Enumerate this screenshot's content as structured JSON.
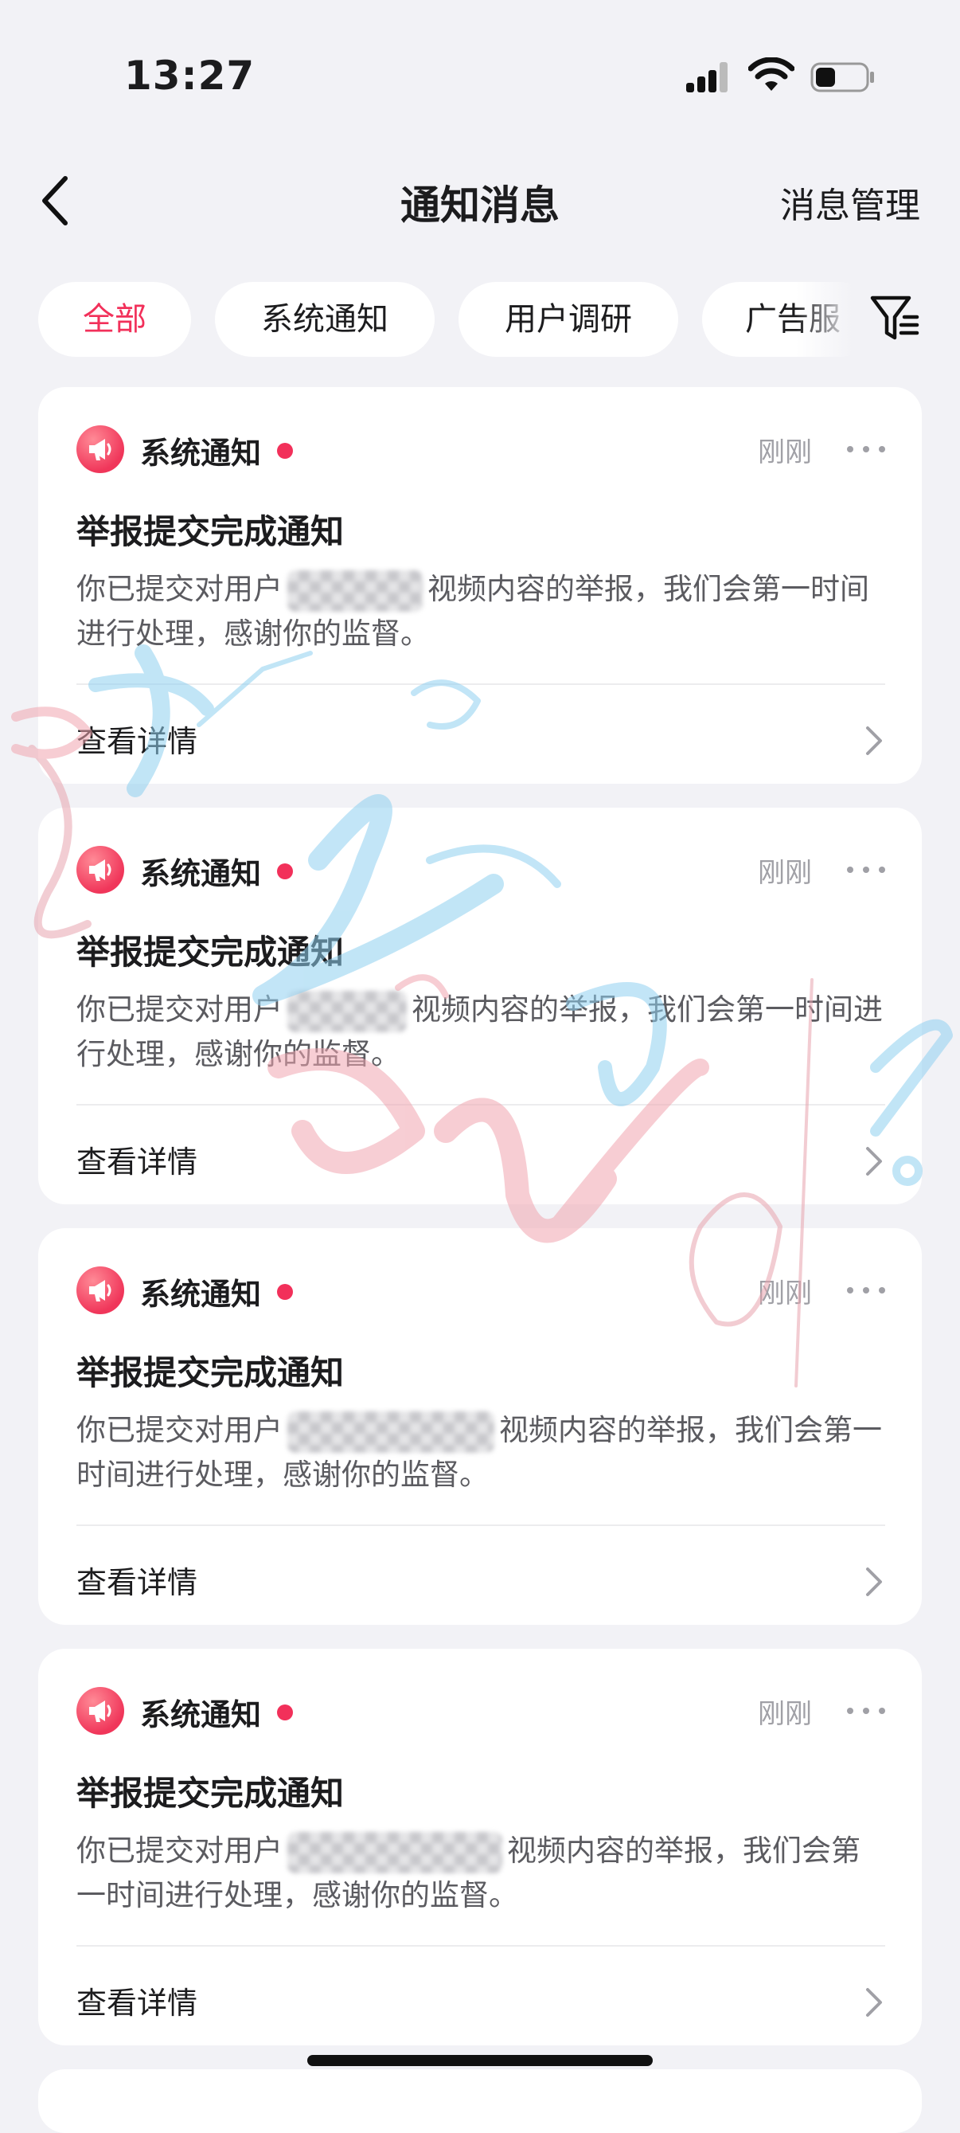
{
  "status_bar": {
    "time": "13:27"
  },
  "nav": {
    "title": "通知消息",
    "right_action": "消息管理"
  },
  "filters": [
    {
      "label": "全部",
      "selected": true
    },
    {
      "label": "系统通知",
      "selected": false
    },
    {
      "label": "用户调研",
      "selected": false
    },
    {
      "label": "广告服",
      "selected": false
    }
  ],
  "notifications": [
    {
      "source": "系统通知",
      "time": "刚刚",
      "title": "举报提交完成通知",
      "body_before": "你已提交对用户",
      "body_after": "视频内容的举报，我们会第一时间进行处理，感谢你的监督。",
      "link": "查看详情"
    },
    {
      "source": "系统通知",
      "time": "刚刚",
      "title": "举报提交完成通知",
      "body_before": "你已提交对用户",
      "body_after": "视频内容的举报，我们会第一时间进行处理，感谢你的监督。",
      "link": "查看详情"
    },
    {
      "source": "系统通知",
      "time": "刚刚",
      "title": "举报提交完成通知",
      "body_before": "你已提交对用户",
      "body_after": "视频内容的举报，我们会第一时间进行处理，感谢你的监督。",
      "link": "查看详情"
    },
    {
      "source": "系统通知",
      "time": "刚刚",
      "title": "举报提交完成通知",
      "body_before": "你已提交对用户",
      "body_after": "视频内容的举报，我们会第一时间进行处理，感谢你的监督。",
      "link": "查看详情"
    }
  ],
  "colors": {
    "accent": "#f2305a",
    "background": "#f2f2f6",
    "muted": "#a0a0a6"
  },
  "icons": [
    "back-chevron-icon",
    "filter-icon",
    "megaphone-icon",
    "more-dots-icon",
    "chevron-right-icon",
    "signal-icon",
    "wifi-icon",
    "battery-icon"
  ]
}
